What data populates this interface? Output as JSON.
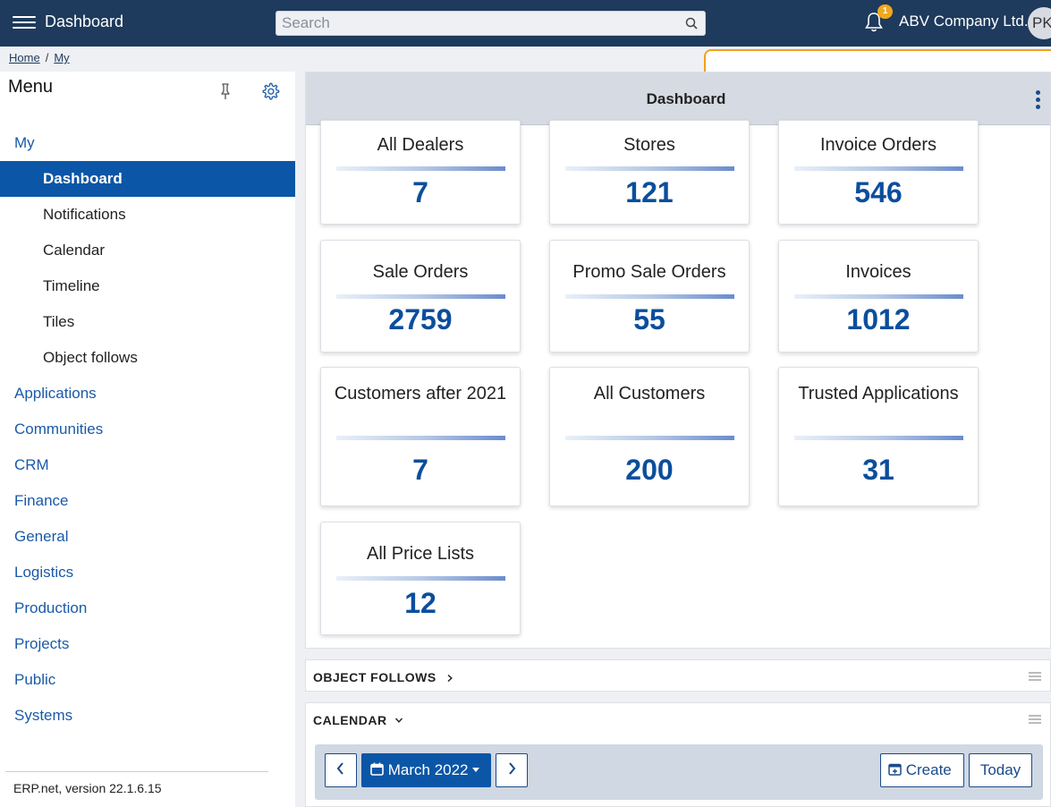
{
  "header": {
    "app_title": "Dashboard",
    "search_placeholder": "Search",
    "notification_count": "1",
    "company": "ABV Company Ltd.",
    "avatar_initials": "PK"
  },
  "breadcrumb": {
    "home": "Home",
    "sep": "/",
    "my": "My"
  },
  "sidebar": {
    "title": "Menu",
    "items": [
      {
        "label": "My",
        "level": "top"
      },
      {
        "label": "Dashboard",
        "level": "sub",
        "active": true
      },
      {
        "label": "Notifications",
        "level": "sub"
      },
      {
        "label": "Calendar",
        "level": "sub"
      },
      {
        "label": "Timeline",
        "level": "sub"
      },
      {
        "label": "Tiles",
        "level": "sub"
      },
      {
        "label": "Object follows",
        "level": "sub"
      },
      {
        "label": "Applications",
        "level": "top"
      },
      {
        "label": "Communities",
        "level": "top"
      },
      {
        "label": "CRM",
        "level": "top"
      },
      {
        "label": "Finance",
        "level": "top"
      },
      {
        "label": "General",
        "level": "top"
      },
      {
        "label": "Logistics",
        "level": "top"
      },
      {
        "label": "Production",
        "level": "top"
      },
      {
        "label": "Projects",
        "level": "top"
      },
      {
        "label": "Public",
        "level": "top"
      },
      {
        "label": "Systems",
        "level": "top"
      }
    ],
    "version": "ERP.net, version 22.1.6.15"
  },
  "dashboard": {
    "title": "Dashboard",
    "tiles": [
      {
        "title": "All Dealers",
        "value": "7"
      },
      {
        "title": "Stores",
        "value": "121"
      },
      {
        "title": "Invoice Orders",
        "value": "546"
      },
      {
        "title": "Sale Orders",
        "value": "2759"
      },
      {
        "title": "Promo Sale Orders",
        "value": "55"
      },
      {
        "title": "Invoices",
        "value": "1012"
      },
      {
        "title": "Customers after 2021",
        "value": "7"
      },
      {
        "title": "All Customers",
        "value": "200"
      },
      {
        "title": "Trusted Applications",
        "value": "31"
      },
      {
        "title": "All Price Lists",
        "value": "12"
      }
    ]
  },
  "object_follows": {
    "title": "OBJECT FOLLOWS",
    "chevron": "›"
  },
  "calendar": {
    "title": "CALENDAR",
    "month": "March 2022",
    "create_label": "Create",
    "today_label": "Today"
  },
  "colors": {
    "topbar": "#1e3a5c",
    "accent": "#0b56a6",
    "tile_value": "#0b4e9c",
    "badge": "#f0a81c",
    "link": "#1a5aa8"
  }
}
